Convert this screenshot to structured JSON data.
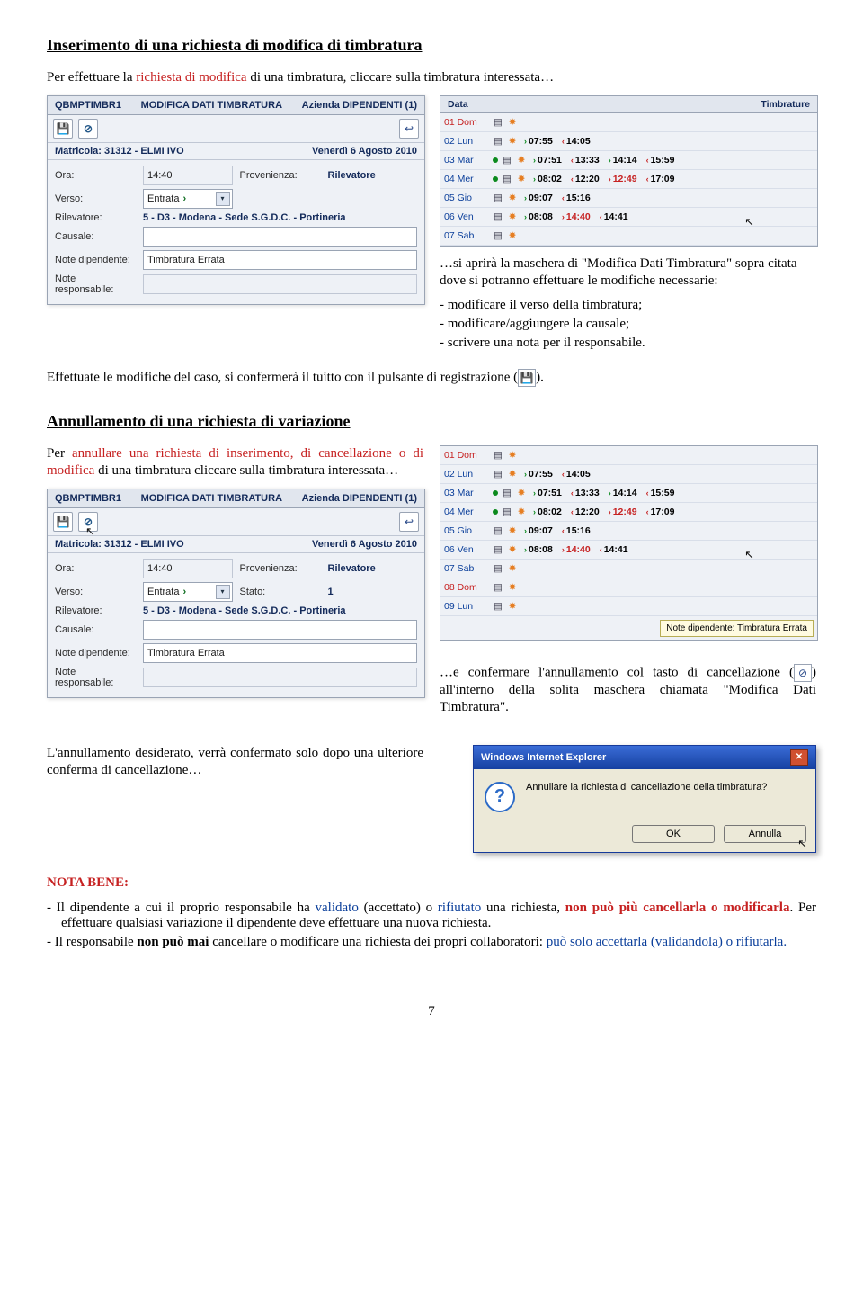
{
  "section1": {
    "title": "Inserimento di una richiesta di modifica di timbratura",
    "para": "Per effettuare la "
  },
  "mod_intro_red": "richiesta di modifica",
  "mod_intro_rest": " di una timbratura, cliccare sulla timbratura interessata…",
  "mask_intro": "…si aprirà la maschera di \"Modifica Dati Timbratura\" sopra citata dove si potranno effettuare le modifiche necessarie:",
  "mask_bullets": [
    "modificare il verso della timbratura;",
    "modificare/aggiungere la causale;",
    "scrivere una nota per il responsabile."
  ],
  "conf_line_a": "Effettuate le modifiche del caso, si confermerà il tuitto con il pulsante di registrazione (",
  "conf_line_b": ").",
  "section2": {
    "title": "Annullamento di una richiesta di variazione",
    "para_a": "Per ",
    "para_red": "annullare una richiesta di inserimento, di cancellazione o di modifica",
    "para_b": " di una timbratura cliccare  sulla timbratura interessata…"
  },
  "conf_annul_a": "…e confermare l'annullamento col tasto di cancellazione (",
  "conf_annul_b": ") all'interno della solita maschera chiamata \"Modifica Dati Timbratura\".",
  "annul_confirm": "L'annullamento desiderato, verrà confermato solo dopo una ulteriore conferma di cancellazione…",
  "nota_bene_title": "NOTA BENE:",
  "nb1_a": "Il dipendente a cui il proprio responsabile ha ",
  "nb1_blue1": "validato",
  "nb1_mid": " (accettato) o ",
  "nb1_blue2": "rifiutato",
  "nb1_b": " una richiesta, ",
  "nb1_red": "non può più cancellarla o modificarla",
  "nb1_c": ". Per effettuare qualsiasi variazione il dipendente deve effettuare una nuova richiesta.",
  "nb2_a": "Il responsabile ",
  "nb2_bold": "non può mai",
  "nb2_b": " cancellare o modificare una richiesta dei propri collaboratori: ",
  "nb2_blue": "può solo accettarla (validandola) o rifiutarla.",
  "form_panel": {
    "code": "QBMPTIMBR1",
    "title": "MODIFICA DATI TIMBRATURA",
    "azienda": "Azienda DIPENDENTI (1)",
    "matricola": "Matricola: 31312 - ELMI IVO",
    "data": "Venerdì 6 Agosto 2010",
    "labels": {
      "ora": "Ora:",
      "prov": "Provenienza:",
      "verso": "Verso:",
      "ril": "Rilevatore:",
      "caus": "Causale:",
      "note_dip": "Note dipendente:",
      "note_resp": "Note responsabile:",
      "stato": "Stato:"
    },
    "values": {
      "ora": "14:40",
      "prov": "Rilevatore",
      "verso": "Entrata",
      "ril": "5 - D3 - Modena - Sede S.G.D.C. - Portineria",
      "caus": "",
      "note_dip": "Timbratura Errata",
      "note_resp": "",
      "stato": "1"
    }
  },
  "timbr": {
    "head_data": "Data",
    "head_timbr": "Timbrature",
    "rows": [
      {
        "day": "01 Dom",
        "red": true,
        "stamps": []
      },
      {
        "day": "02 Lun",
        "stamps": [
          {
            "in": "07:55"
          },
          {
            "out": "14:05"
          }
        ]
      },
      {
        "day": "03 Mar",
        "dot": true,
        "stamps": [
          {
            "in": "07:51"
          },
          {
            "out": "13:33"
          },
          {
            "in": "14:14"
          },
          {
            "out": "15:59"
          }
        ]
      },
      {
        "day": "04 Mer",
        "dot": true,
        "stamps": [
          {
            "in": "08:02"
          },
          {
            "out": "12:20"
          },
          {
            "in": "12:49",
            "pending": true
          },
          {
            "out": "17:09"
          }
        ]
      },
      {
        "day": "05 Gio",
        "stamps": [
          {
            "in": "09:07"
          },
          {
            "out": "15:16"
          }
        ]
      },
      {
        "day": "06 Ven",
        "stamps": [
          {
            "in": "08:08"
          },
          {
            "in": "14:40",
            "pending": true
          },
          {
            "out": "14:41"
          }
        ]
      },
      {
        "day": "07 Sab",
        "stamps": []
      }
    ],
    "tooltip": "Note dipendente: Timbratura Errata"
  },
  "timbr2_extra": [
    {
      "day": "08 Dom",
      "red": true,
      "stamps": []
    },
    {
      "day": "09 Lun",
      "stamps": []
    }
  ],
  "windlg": {
    "title": "Windows Internet Explorer",
    "msg": "Annullare la richiesta di cancellazione della timbratura?",
    "ok": "OK",
    "cancel": "Annulla"
  },
  "page": "7"
}
